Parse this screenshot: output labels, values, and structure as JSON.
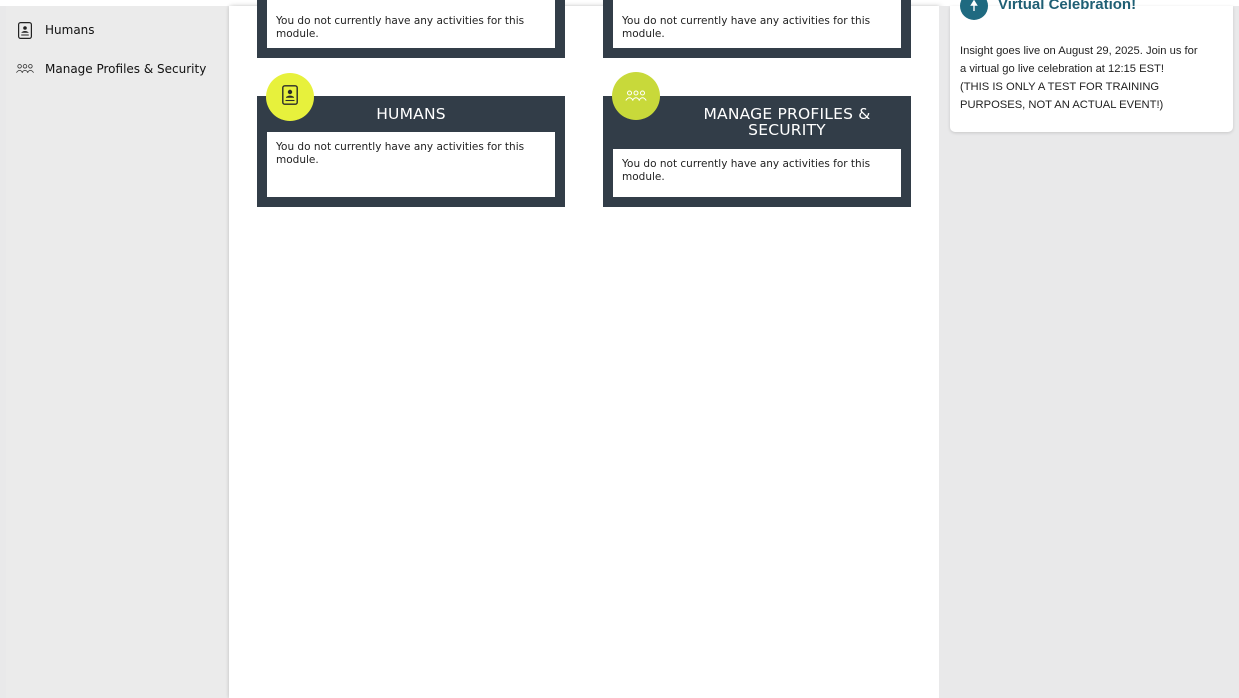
{
  "sidebar": {
    "items": [
      {
        "label": "Humans",
        "icon": "id-card-icon"
      },
      {
        "label": "Manage Profiles & Security",
        "icon": "users-icon"
      }
    ]
  },
  "main": {
    "cards": [
      {
        "title": "",
        "body": "You do not currently have any activities for this module."
      },
      {
        "title": "",
        "body": "You do not currently have any activities for this module."
      },
      {
        "title": "HUMANS",
        "body": "You do not currently have any activities for this module.",
        "icon": "id-card-icon",
        "badge_color": "#e7f13c"
      },
      {
        "title_line1": "MANAGE PROFILES &",
        "title_line2": "SECURITY",
        "body": "You do not currently have any activities for this module.",
        "icon": "users-icon",
        "badge_color": "#c8d93a"
      }
    ]
  },
  "announcement": {
    "title": "Virtual Celebration!",
    "line1": "Insight goes live on August 29, 2025. Join us for",
    "line2": "a virtual go live celebration at 12:15 EST!",
    "line3": "(THIS IS ONLY A TEST FOR TRAINING",
    "line4": "PURPOSES, NOT AN ACTUAL EVENT!)"
  },
  "colors": {
    "card_bg": "#323d48",
    "accent_teal": "#1f5f74"
  }
}
